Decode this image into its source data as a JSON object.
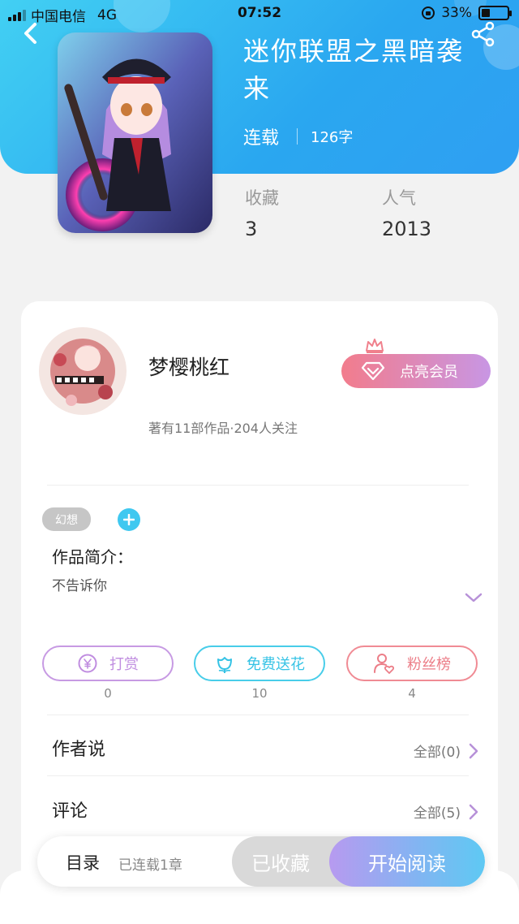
{
  "status_bar": {
    "carrier": "中国电信",
    "network": "4G",
    "time": "07:52",
    "battery": "33%",
    "battery_level": 0.33
  },
  "book": {
    "title": "迷你联盟之黑暗袭来",
    "status": "连载",
    "word_count": "126字",
    "favorites_label": "收藏",
    "favorites": "3",
    "popularity_label": "人气",
    "popularity": "2013"
  },
  "author": {
    "name": "梦樱桃红",
    "stats": "著有11部作品·204人关注",
    "vip_label": "点亮会员"
  },
  "tags": [
    "幻想"
  ],
  "intro": {
    "label": "作品简介：",
    "text": "不告诉你"
  },
  "actions": [
    {
      "label": "打赏",
      "count": "0",
      "icon": "yen-coin-icon",
      "color": "#c08de0"
    },
    {
      "label": "免费送花",
      "count": "10",
      "icon": "flower-icon",
      "color": "#36c3e5"
    },
    {
      "label": "粉丝榜",
      "count": "4",
      "icon": "fan-user-heart-icon",
      "color": "#ec7e88"
    }
  ],
  "sections": {
    "author_says": {
      "label": "作者说",
      "link": "全部(0)"
    },
    "comments": {
      "label": "评论",
      "link": "全部(5)"
    }
  },
  "bottom_bar": {
    "toc_label": "目录",
    "toc_sub": "已连载1章",
    "favorited_label": "已收藏",
    "read_label": "开始阅读"
  },
  "colors": {
    "header_blue": "#2aa7f0",
    "accent_cyan": "#3fc8f0",
    "vip_gradient_start": "#f27c8c",
    "vip_gradient_end": "#c896e4"
  }
}
